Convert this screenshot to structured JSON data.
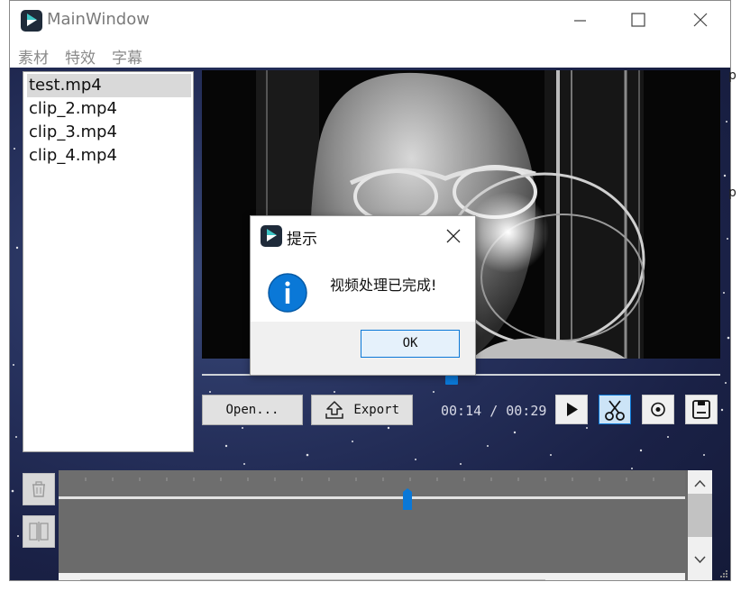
{
  "window": {
    "title": "MainWindow",
    "controls": [
      "minimize",
      "maximize",
      "close"
    ]
  },
  "menu": {
    "items": [
      "素材",
      "特效",
      "字幕"
    ]
  },
  "file_list": {
    "items": [
      {
        "label": "test.mp4",
        "selected": true
      },
      {
        "label": "clip_2.mp4",
        "selected": false
      },
      {
        "label": "clip_3.mp4",
        "selected": false
      },
      {
        "label": "clip_4.mp4",
        "selected": false
      }
    ]
  },
  "player": {
    "open_label": "Open...",
    "export_label": "Export",
    "current_time": "00:14",
    "separator": "/",
    "total_time": "00:29",
    "progress_fraction": 0.48
  },
  "tools": {
    "play": "play-icon",
    "cut": "scissors-icon",
    "record": "record-icon",
    "save": "save-icon"
  },
  "timeline": {
    "playhead_fraction": 0.55
  },
  "dialog": {
    "title": "提示",
    "message": "视频处理已完成!",
    "ok_label": "OK"
  },
  "colors": {
    "accent": "#0a78d7",
    "background_gradient": "#27325e",
    "timeline": "#6b6b6b"
  },
  "edge_text": [
    "p",
    "p"
  ]
}
